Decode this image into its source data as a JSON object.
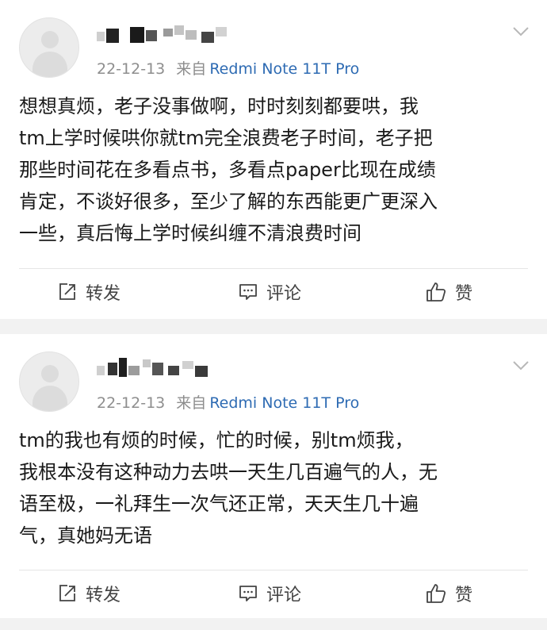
{
  "posts": [
    {
      "date": "22-12-13",
      "source_prefix": "来自",
      "source_device": "Redmi Note 11T Pro",
      "content": "想想真烦，老子没事做啊，时时刻刻都要哄，我\ntm上学时候哄你就tm完全浪费老子时间，老子把\n那些时间花在多看点书，多看点paper比现在成绩\n肯定，不谈好很多，至少了解的东西能更广更深入\n一些，真后悔上学时候纠缠不清浪费时间",
      "actions": {
        "repost": "转发",
        "comment": "评论",
        "like": "赞"
      }
    },
    {
      "date": "22-12-13",
      "source_prefix": "来自",
      "source_device": "Redmi Note 11T Pro",
      "content": "tm的我也有烦的时候，忙的时候，别tm烦我，\n我根本没有这种动力去哄一天生几百遍气的人，无\n语至极，一礼拜生一次气还正常，天天生几十遍\n气，真她妈无语",
      "actions": {
        "repost": "转发",
        "comment": "评论",
        "like": "赞"
      }
    }
  ],
  "colors": {
    "source_link": "#2e6bb3",
    "meta_gray": "#8e8e8e",
    "background": "#f2f2f2"
  },
  "icons": [
    "avatar-placeholder",
    "chevron-down-icon",
    "repost-icon",
    "comment-icon",
    "like-icon"
  ]
}
